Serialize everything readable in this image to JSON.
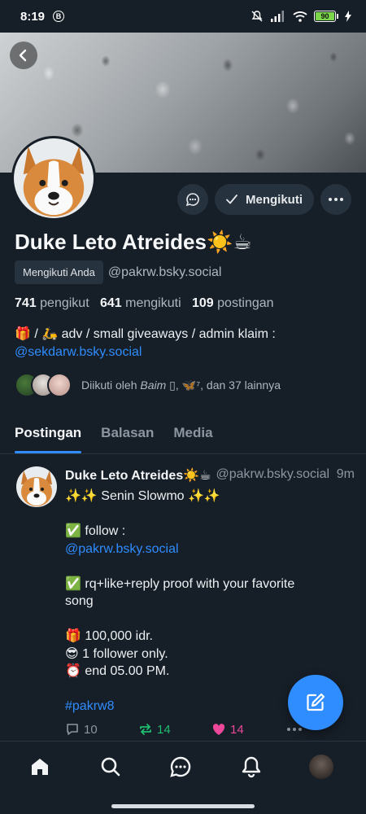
{
  "status_bar": {
    "time": "8:19",
    "b_icon": "B",
    "battery": "90"
  },
  "profile": {
    "display_name": "Duke Leto Atreides☀️☕",
    "follows_you_badge": "Mengikuti Anda",
    "handle": "@pakrw.bsky.social",
    "stats": {
      "followers_count": "741",
      "followers_label": "pengikut",
      "following_count": "641",
      "following_label": "mengikuti",
      "posts_count": "109",
      "posts_label": "postingan"
    },
    "bio_line1": "🎁 / 🛵 adv / small giveaways / admin klaim :",
    "bio_link": "@sekdarw.bsky.social",
    "followed_by_prefix": "Diikuti oleh ",
    "followed_by_name": "Baim",
    "followed_by_suffix": " ▯, 🦋⁷, dan 37 lainnya"
  },
  "actions": {
    "follow_label": "Mengikuti"
  },
  "tabs": [
    {
      "label": "Postingan",
      "active": true
    },
    {
      "label": "Balasan",
      "active": false
    },
    {
      "label": "Media",
      "active": false
    }
  ],
  "post": {
    "author_name": "Duke Leto Atreides☀️☕",
    "author_handle": "@pakrw.bsky.social",
    "time": "9m",
    "lines": [
      "✨✨ Senin Slowmo ✨✨",
      "",
      "✅ follow :",
      "@pakrw.bsky.social",
      "",
      "✅ rq+like+reply proof with your favorite",
      "song",
      "",
      "🎁 100,000 idr.",
      "😎 1 follower only.",
      "⏰  end 05.00 PM.",
      "",
      "#pakrw8"
    ],
    "reply_count": "10",
    "repost_count": "14",
    "like_count": "14"
  },
  "colors": {
    "background": "#161e27",
    "accent": "#2f8dff",
    "repost": "#20bc6f",
    "like": "#ec4899"
  },
  "icons": {
    "back": "chevron-left-icon",
    "message": "chat-bubble-icon",
    "follow_check": "check-icon",
    "more": "ellipsis-icon",
    "fab": "compose-icon",
    "nav": [
      "home-icon",
      "search-icon",
      "chat-icon",
      "bell-icon",
      "profile-avatar"
    ]
  }
}
